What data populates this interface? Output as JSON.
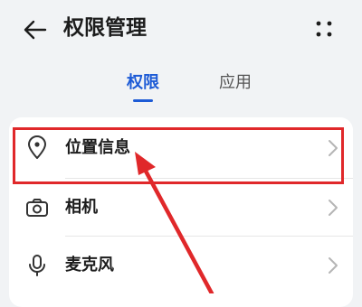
{
  "header": {
    "title": "权限管理",
    "back_icon": "back-arrow-icon",
    "more_icon": "more-dots-icon"
  },
  "tabs": [
    {
      "label": "权限",
      "active": true
    },
    {
      "label": "应用",
      "active": false
    }
  ],
  "permissions": [
    {
      "label": "位置信息",
      "icon": "location-pin-icon"
    },
    {
      "label": "相机",
      "icon": "camera-icon"
    },
    {
      "label": "麦克风",
      "icon": "microphone-icon"
    }
  ],
  "annotation": {
    "highlight_color": "#e0282a",
    "highlighted_item": "位置信息"
  },
  "colors": {
    "accent": "#1d5bd6",
    "background": "#f1f3f5",
    "card": "#ffffff"
  }
}
